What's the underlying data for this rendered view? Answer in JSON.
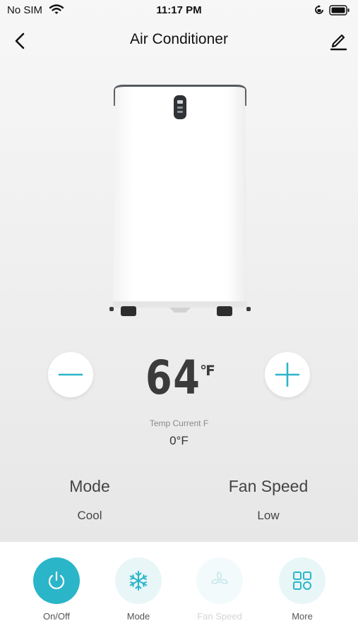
{
  "status_bar": {
    "carrier": "No SIM",
    "time": "11:17 PM"
  },
  "nav": {
    "title": "Air Conditioner"
  },
  "temperature": {
    "setpoint": "64",
    "unit": "℉",
    "current_label": "Temp Current F",
    "current_value": "0°F"
  },
  "info": {
    "mode_title": "Mode",
    "mode_value": "Cool",
    "fan_title": "Fan Speed",
    "fan_value": "Low"
  },
  "actions": {
    "onoff": "On/Off",
    "mode": "Mode",
    "fan_speed": "Fan Speed",
    "more": "More"
  },
  "colors": {
    "accent": "#2bb5c8",
    "accent_light": "#e8f6f8"
  },
  "icons": {
    "wifi": "wifi-icon",
    "lock": "orientation-lock-icon",
    "battery": "battery-icon",
    "back": "chevron-left-icon",
    "edit": "pencil-icon",
    "minus": "minus-icon",
    "plus": "plus-icon",
    "power": "power-icon",
    "snowflake": "snowflake-icon",
    "fan": "fan-icon",
    "grid": "grid-icon"
  }
}
